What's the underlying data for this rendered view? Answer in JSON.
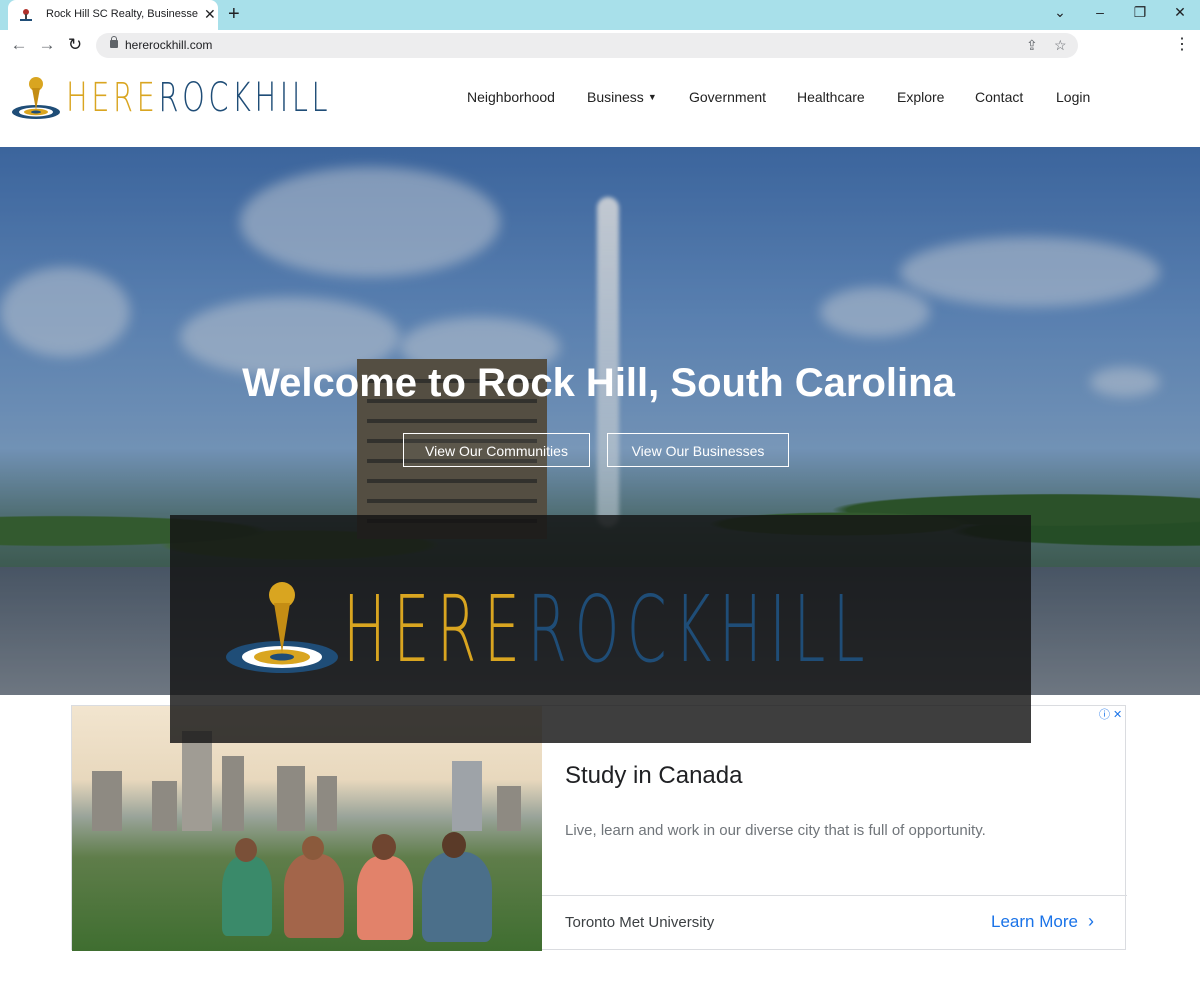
{
  "browser": {
    "tab_title": "Rock Hill SC Realty, Businesses, S",
    "new_tab_symbol": "+",
    "close_symbol": "✕",
    "url": "hererockhill.com",
    "window_controls": {
      "minimize": "–",
      "restore": "❐",
      "close": "✕",
      "tabs_dropdown": "⌄"
    }
  },
  "site": {
    "logo": {
      "here": "HERE",
      "rock": "ROCKHILL"
    },
    "nav": [
      {
        "label": "Neighborhood"
      },
      {
        "label": "Business",
        "has_dropdown": true
      },
      {
        "label": "Government"
      },
      {
        "label": "Healthcare"
      },
      {
        "label": "Explore"
      },
      {
        "label": "Contact"
      },
      {
        "label": "Login"
      }
    ]
  },
  "hero": {
    "title": "Welcome to Rock Hill, South Carolina",
    "buttons": [
      {
        "label": "View Our Communities"
      },
      {
        "label": "View Our Businesses"
      }
    ]
  },
  "ad": {
    "headline": "Study in Canada",
    "description": "Live, learn and work in our diverse city that is full of opportunity.",
    "advertiser": "Toronto Met University",
    "cta": "Learn More",
    "adchoices": "ⓘ ✕"
  },
  "overlay": {
    "here": "HERE",
    "rock": "ROCKHILL"
  },
  "colors": {
    "gold": "#d9a520",
    "navy": "#1f4d77",
    "link_blue": "#1a73e8",
    "tabbar": "#a8e0ea"
  }
}
